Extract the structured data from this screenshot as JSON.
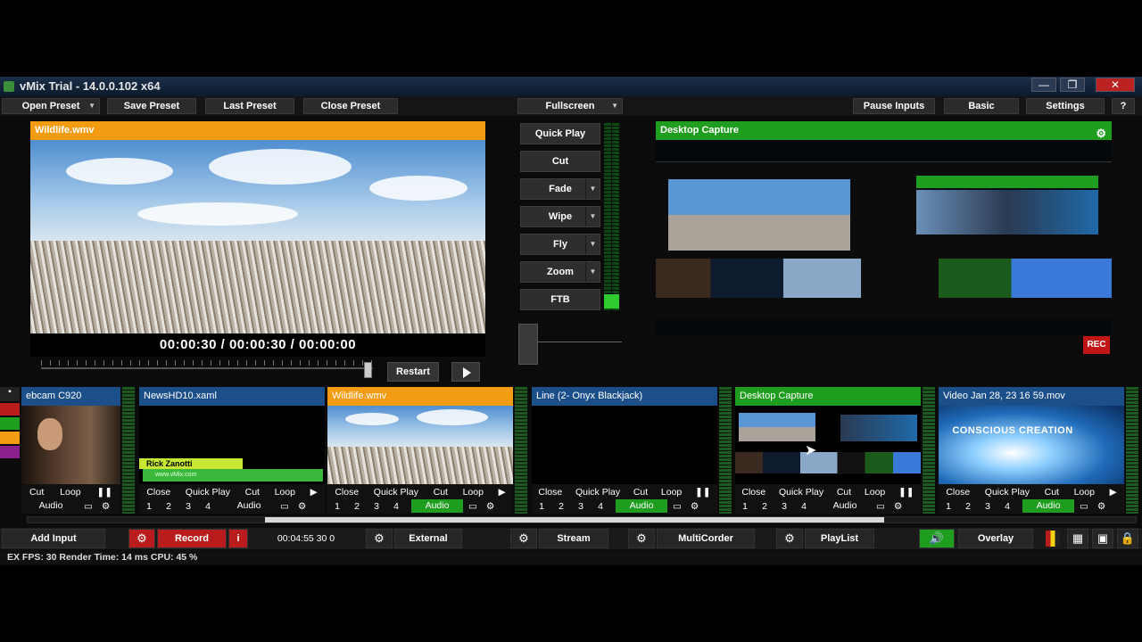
{
  "window": {
    "title": "vMix Trial - 14.0.0.102 x64",
    "minimize": "—",
    "maximize": "❐",
    "close": "✕"
  },
  "toolbar": {
    "open_preset": "Open Preset",
    "save_preset": "Save Preset",
    "last_preset": "Last Preset",
    "close_preset": "Close Preset",
    "fullscreen": "Fullscreen",
    "pause_inputs": "Pause Inputs",
    "basic": "Basic",
    "settings": "Settings",
    "help": "?"
  },
  "preview": {
    "title": "Wildlife.wmv",
    "timecode": "00:00:30  /  00:00:30  /  00:00:00",
    "restart": "Restart"
  },
  "transitions": [
    "Quick Play",
    "Cut",
    "Fade",
    "Wipe",
    "Fly",
    "Zoom",
    "FTB"
  ],
  "output": {
    "title": "Desktop Capture",
    "rec_badge": "REC"
  },
  "inputs": [
    {
      "title": "ebcam C920",
      "header_color": "#1c4f8a",
      "controls": [
        "Cut",
        "Loop"
      ],
      "numbers": [],
      "audio": "Audio",
      "audio_on": false,
      "play_state": "pause"
    },
    {
      "title": "NewsHD10.xaml",
      "header_color": "#1c4f8a",
      "controls": [
        "Close",
        "Quick Play",
        "Cut",
        "Loop"
      ],
      "numbers": [
        "1",
        "2",
        "3",
        "4"
      ],
      "audio": "Audio",
      "audio_on": false,
      "play_state": "play",
      "lower_third_name": "Rick Zanotti",
      "lower_third_sub": "www.vMix.com"
    },
    {
      "title": "Wildlife.wmv",
      "header_color": "#f39c12",
      "controls": [
        "Close",
        "Quick Play",
        "Cut",
        "Loop"
      ],
      "numbers": [
        "1",
        "2",
        "3",
        "4"
      ],
      "audio": "Audio",
      "audio_on": true,
      "play_state": "play"
    },
    {
      "title": "Line (2- Onyx Blackjack)",
      "header_color": "#1c4f8a",
      "controls": [
        "Close",
        "Quick Play",
        "Cut",
        "Loop"
      ],
      "numbers": [
        "1",
        "2",
        "3",
        "4"
      ],
      "audio": "Audio",
      "audio_on": true,
      "play_state": "pause"
    },
    {
      "title": "Desktop Capture",
      "header_color": "#1f9d1f",
      "controls": [
        "Close",
        "Quick Play",
        "Cut",
        "Loop"
      ],
      "numbers": [
        "1",
        "2",
        "3",
        "4"
      ],
      "audio": "Audio",
      "audio_on": false,
      "play_state": "pause"
    },
    {
      "title": "Video Jan 28, 23 16 59.mov",
      "header_color": "#1c4f8a",
      "controls": [
        "Close",
        "Quick Play",
        "Cut",
        "Loop"
      ],
      "numbers": [
        "1",
        "2",
        "3",
        "4"
      ],
      "audio": "Audio",
      "audio_on": true,
      "play_state": "play",
      "overlay_text": "CONSCIOUS CREATION"
    }
  ],
  "bottom": {
    "add_input": "Add Input",
    "record": "Record",
    "record_info": "i",
    "record_time": "00:04:55 30 0",
    "external": "External",
    "stream": "Stream",
    "multicorder": "MultiCorder",
    "playlist": "PlayList",
    "overlay": "Overlay"
  },
  "status": {
    "text": "EX  FPS:  30   Render Time:  14 ms   CPU:  45 %"
  },
  "colors": {
    "preview_accent": "#f39c12",
    "output_accent": "#1f9d1f",
    "record_red": "#b81c1c",
    "input_blue": "#1c4f8a"
  }
}
